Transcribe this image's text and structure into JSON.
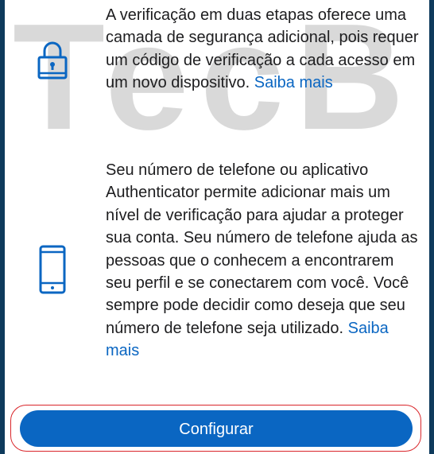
{
  "watermark": {
    "text": "TecB"
  },
  "two_step": {
    "icon": "lock-icon",
    "description": "A verificação em duas etapas oferece uma camada de segurança adicional, pois requer um código de verificação a cada acesso em um novo dispositivo. ",
    "link_label": "Saiba mais"
  },
  "phone": {
    "icon": "smartphone-icon",
    "description": "Seu número de telefone ou aplicativo Authenticator permite adicionar mais um nível de verificação para ajudar a proteger sua conta. Seu número de telefone ajuda as pessoas que o conhecem a encontrarem seu perfil e se conectarem com você. Você sempre pode decidir como deseja que seu número de telefone seja utilizado. ",
    "link_label": "Saiba mais"
  },
  "primary_button": {
    "label": "Configurar"
  },
  "colors": {
    "accent": "#0a66c2",
    "highlight_outline": "#d9252a",
    "background": "#ffffff"
  }
}
